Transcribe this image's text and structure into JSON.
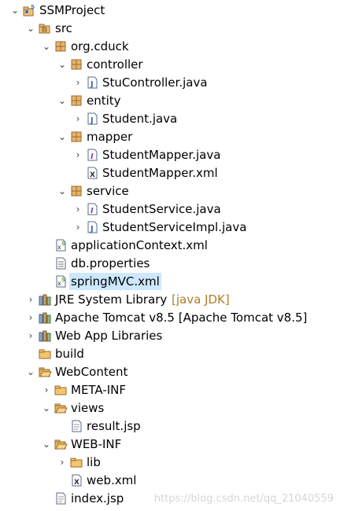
{
  "tree": {
    "nodes": [
      {
        "label": "SSMProject",
        "toggle": "expanded",
        "icon": "java-project-icon",
        "selected": false
      },
      {
        "label": "src",
        "toggle": "expanded",
        "icon": "source-folder-icon",
        "selected": false
      },
      {
        "label": "org.cduck",
        "toggle": "expanded",
        "icon": "package-icon",
        "selected": false
      },
      {
        "label": "controller",
        "toggle": "expanded",
        "icon": "package-icon",
        "selected": false
      },
      {
        "label": "StuController.java",
        "toggle": "collapsed",
        "icon": "java-file-icon",
        "selected": false
      },
      {
        "label": "entity",
        "toggle": "expanded",
        "icon": "package-icon",
        "selected": false
      },
      {
        "label": "Student.java",
        "toggle": "collapsed",
        "icon": "java-file-icon",
        "selected": false
      },
      {
        "label": "mapper",
        "toggle": "expanded",
        "icon": "package-icon",
        "selected": false
      },
      {
        "label": "StudentMapper.java",
        "toggle": "collapsed",
        "icon": "java-interface-icon",
        "selected": false
      },
      {
        "label": "StudentMapper.xml",
        "toggle": "none",
        "icon": "xml-file-icon",
        "selected": false
      },
      {
        "label": "service",
        "toggle": "expanded",
        "icon": "package-icon",
        "selected": false
      },
      {
        "label": "StudentService.java",
        "toggle": "collapsed",
        "icon": "java-interface-icon",
        "selected": false
      },
      {
        "label": "StudentServiceImpl.java",
        "toggle": "collapsed",
        "icon": "java-file-icon",
        "selected": false
      },
      {
        "label": "applicationContext.xml",
        "toggle": "none",
        "icon": "spring-xml-icon",
        "selected": false
      },
      {
        "label": "db.properties",
        "toggle": "none",
        "icon": "properties-file-icon",
        "selected": false
      },
      {
        "label": "springMVC.xml",
        "toggle": "none",
        "icon": "spring-xml-icon",
        "selected": true
      },
      {
        "label": "JRE System Library",
        "decoration": "[java JDK]",
        "toggle": "collapsed",
        "icon": "library-icon",
        "selected": false
      },
      {
        "label": "Apache Tomcat v8.5 [Apache Tomcat v8.5]",
        "toggle": "collapsed",
        "icon": "library-icon",
        "selected": false
      },
      {
        "label": "Web App Libraries",
        "toggle": "collapsed",
        "icon": "library-icon",
        "selected": false
      },
      {
        "label": "build",
        "toggle": "none",
        "icon": "folder-icon",
        "selected": false
      },
      {
        "label": "WebContent",
        "toggle": "expanded",
        "icon": "folder-open-icon",
        "selected": false
      },
      {
        "label": "META-INF",
        "toggle": "collapsed",
        "icon": "folder-icon",
        "selected": false
      },
      {
        "label": "views",
        "toggle": "expanded",
        "icon": "folder-open-icon",
        "selected": false
      },
      {
        "label": "result.jsp",
        "toggle": "none",
        "icon": "jsp-file-icon",
        "selected": false
      },
      {
        "label": "WEB-INF",
        "toggle": "expanded",
        "icon": "folder-open-icon",
        "selected": false
      },
      {
        "label": "lib",
        "toggle": "collapsed",
        "icon": "folder-icon",
        "selected": false
      },
      {
        "label": "web.xml",
        "toggle": "none",
        "icon": "xml-file-icon",
        "selected": false
      },
      {
        "label": "index.jsp",
        "toggle": "none",
        "icon": "jsp-file-icon",
        "selected": false
      }
    ]
  },
  "watermark": "https://blog.csdn.net/qq_21040559"
}
